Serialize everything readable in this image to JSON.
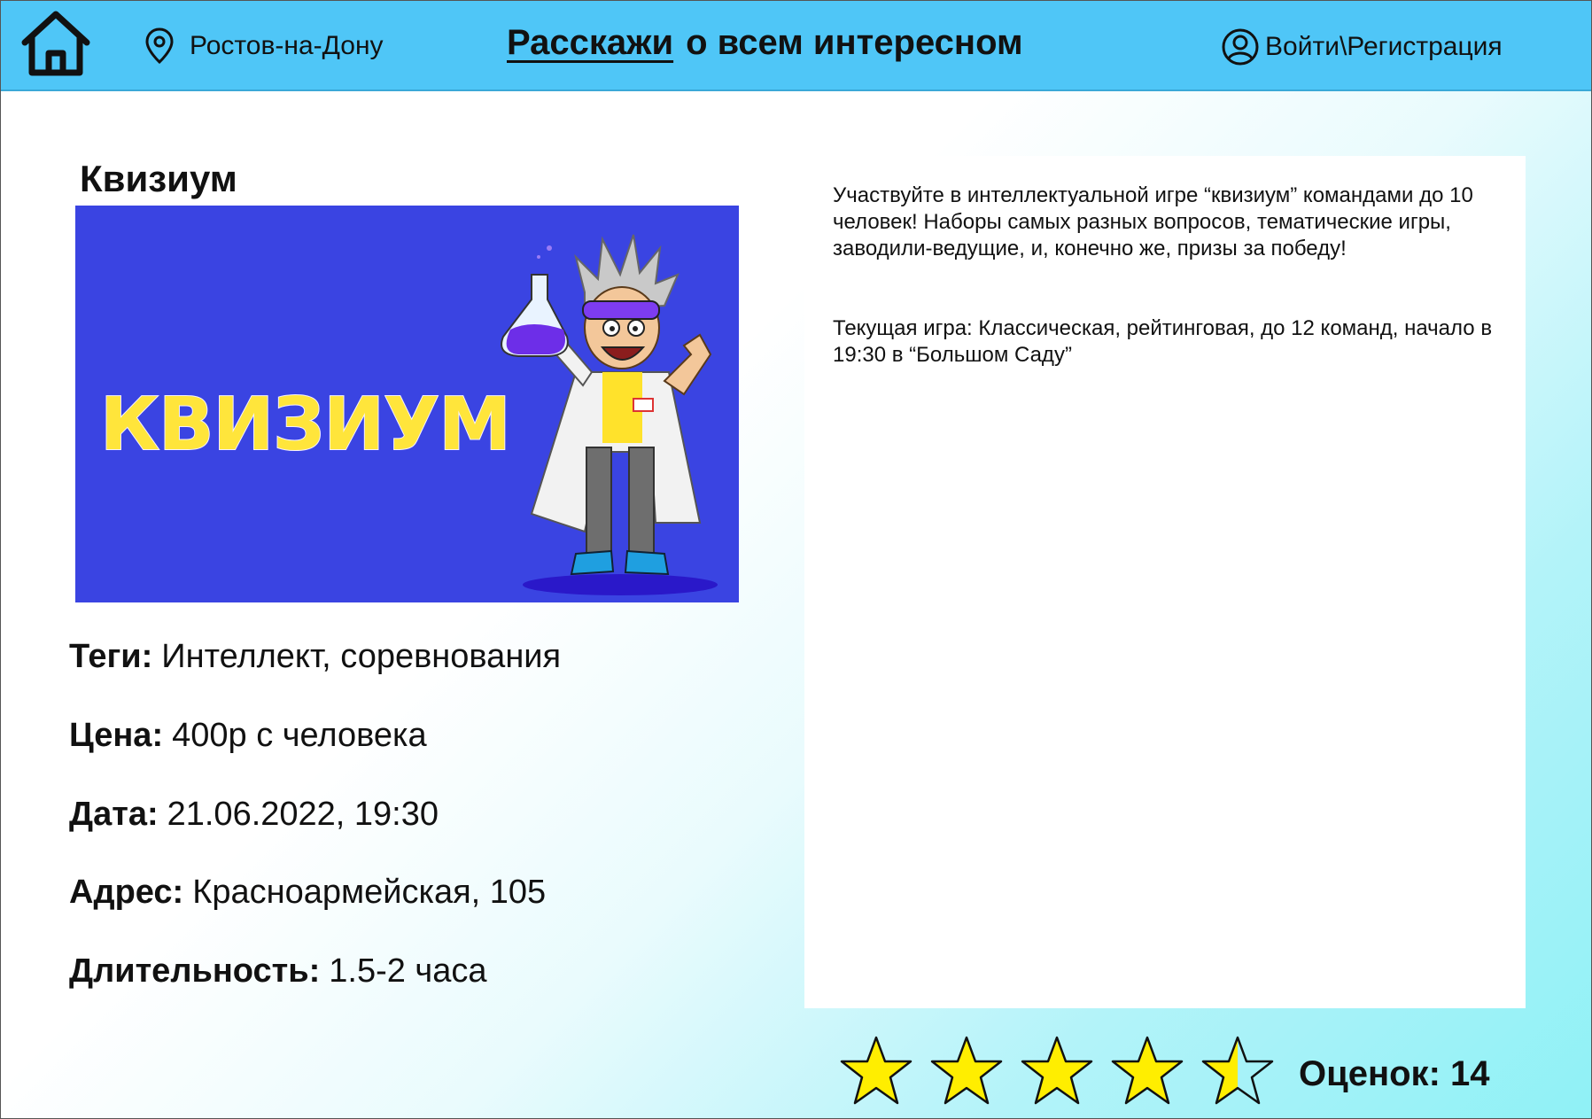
{
  "header": {
    "city": "Ростов-на-Дону",
    "title_brand": "Расскажи",
    "title_rest": "о всем интересном",
    "login_label": "Войти\\Регистрация",
    "background_color": "#4fc6f7"
  },
  "event": {
    "title": "Квизиум",
    "image": {
      "logo_text": "КВИЗИУМ",
      "background_color": "#3a44e2",
      "logo_color": "#ffe53b"
    },
    "details": [
      {
        "label": "Теги:",
        "value": "Интеллект, соревнования"
      },
      {
        "label": "Цена:",
        "value": "400р с человека"
      },
      {
        "label": "Дата:",
        "value": "21.06.2022, 19:30"
      },
      {
        "label": "Адрес:",
        "value": "Красноармейская, 105"
      },
      {
        "label": "Длительность:",
        "value": "1.5-2 часа"
      }
    ],
    "description": [
      "Участвуйте в интеллектуальной игре “квизиум” командами до 10 человек! Наборы самых разных вопросов, тематические игры, заводили-ведущие, и, конечно же, призы за победу!",
      "Текущая игра: Классическая, рейтинговая, до 12 команд, начало в 19:30 в “Большом Саду”"
    ]
  },
  "rating": {
    "stars_total": 5,
    "score": 4.5,
    "star_color": "#ffee00",
    "count_label": "Оценок: 14"
  },
  "icons": {
    "home": "home-icon",
    "location": "location-pin-icon",
    "user": "user-circle-icon",
    "star": "star-icon"
  }
}
